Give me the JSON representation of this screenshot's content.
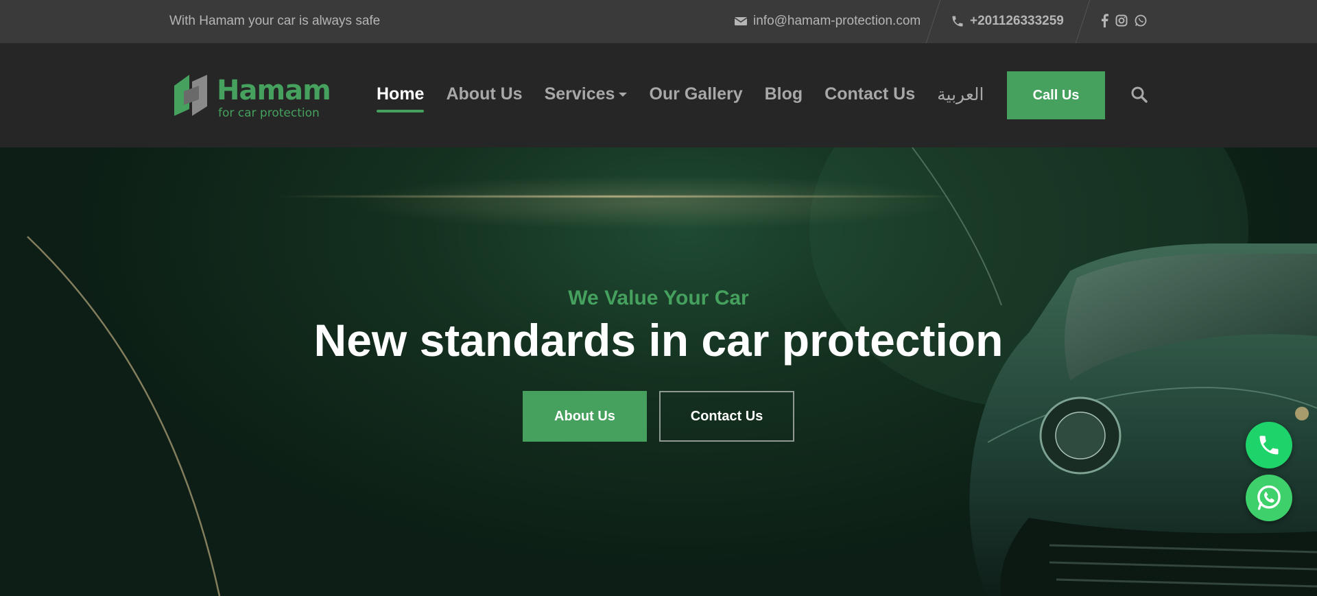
{
  "topbar": {
    "tagline": "With Hamam your car is always safe",
    "email": "info@hamam-protection.com",
    "phone": "+201126333259",
    "socials": [
      "facebook-icon",
      "instagram-icon",
      "whatsapp-icon"
    ]
  },
  "logo": {
    "name": "Hamam",
    "subtitle": "for car protection"
  },
  "nav": {
    "items": [
      {
        "label": "Home",
        "active": true
      },
      {
        "label": "About Us"
      },
      {
        "label": "Services",
        "has_dropdown": true
      },
      {
        "label": "Our Gallery"
      },
      {
        "label": "Blog"
      },
      {
        "label": "Contact Us"
      },
      {
        "label": "العربية"
      }
    ],
    "cta": "Call Us"
  },
  "hero": {
    "kicker": "We Value Your Car",
    "headline": "New standards in car protection",
    "primary_button": "About Us",
    "secondary_button": "Contact Us"
  },
  "floating": {
    "phone_icon": "phone-icon",
    "whatsapp_icon": "whatsapp-icon"
  },
  "colors": {
    "accent": "#45a15d",
    "topbar_bg": "#3a3a3a",
    "header_bg": "#262626",
    "hero_bg": "#14301f",
    "float_green": "#1fd36b"
  }
}
